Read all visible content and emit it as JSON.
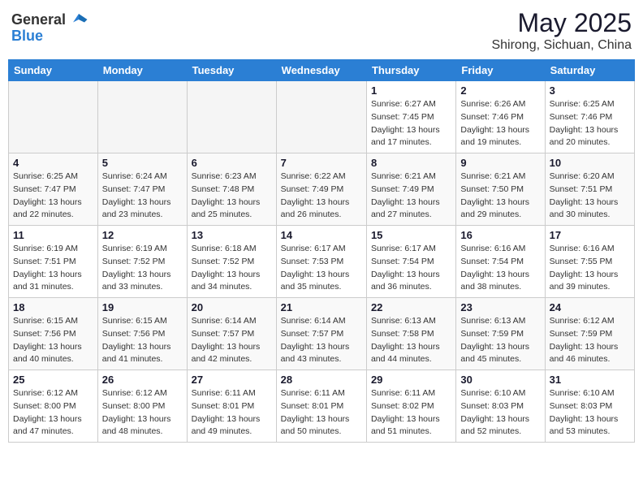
{
  "header": {
    "logo_general": "General",
    "logo_blue": "Blue",
    "month": "May 2025",
    "location": "Shirong, Sichuan, China"
  },
  "weekdays": [
    "Sunday",
    "Monday",
    "Tuesday",
    "Wednesday",
    "Thursday",
    "Friday",
    "Saturday"
  ],
  "weeks": [
    [
      {
        "day": "",
        "sunrise": "",
        "sunset": "",
        "daylight": ""
      },
      {
        "day": "",
        "sunrise": "",
        "sunset": "",
        "daylight": ""
      },
      {
        "day": "",
        "sunrise": "",
        "sunset": "",
        "daylight": ""
      },
      {
        "day": "",
        "sunrise": "",
        "sunset": "",
        "daylight": ""
      },
      {
        "day": "1",
        "sunrise": "6:27 AM",
        "sunset": "7:45 PM",
        "daylight": "13 hours and 17 minutes."
      },
      {
        "day": "2",
        "sunrise": "6:26 AM",
        "sunset": "7:46 PM",
        "daylight": "13 hours and 19 minutes."
      },
      {
        "day": "3",
        "sunrise": "6:25 AM",
        "sunset": "7:46 PM",
        "daylight": "13 hours and 20 minutes."
      }
    ],
    [
      {
        "day": "4",
        "sunrise": "6:25 AM",
        "sunset": "7:47 PM",
        "daylight": "13 hours and 22 minutes."
      },
      {
        "day": "5",
        "sunrise": "6:24 AM",
        "sunset": "7:47 PM",
        "daylight": "13 hours and 23 minutes."
      },
      {
        "day": "6",
        "sunrise": "6:23 AM",
        "sunset": "7:48 PM",
        "daylight": "13 hours and 25 minutes."
      },
      {
        "day": "7",
        "sunrise": "6:22 AM",
        "sunset": "7:49 PM",
        "daylight": "13 hours and 26 minutes."
      },
      {
        "day": "8",
        "sunrise": "6:21 AM",
        "sunset": "7:49 PM",
        "daylight": "13 hours and 27 minutes."
      },
      {
        "day": "9",
        "sunrise": "6:21 AM",
        "sunset": "7:50 PM",
        "daylight": "13 hours and 29 minutes."
      },
      {
        "day": "10",
        "sunrise": "6:20 AM",
        "sunset": "7:51 PM",
        "daylight": "13 hours and 30 minutes."
      }
    ],
    [
      {
        "day": "11",
        "sunrise": "6:19 AM",
        "sunset": "7:51 PM",
        "daylight": "13 hours and 31 minutes."
      },
      {
        "day": "12",
        "sunrise": "6:19 AM",
        "sunset": "7:52 PM",
        "daylight": "13 hours and 33 minutes."
      },
      {
        "day": "13",
        "sunrise": "6:18 AM",
        "sunset": "7:52 PM",
        "daylight": "13 hours and 34 minutes."
      },
      {
        "day": "14",
        "sunrise": "6:17 AM",
        "sunset": "7:53 PM",
        "daylight": "13 hours and 35 minutes."
      },
      {
        "day": "15",
        "sunrise": "6:17 AM",
        "sunset": "7:54 PM",
        "daylight": "13 hours and 36 minutes."
      },
      {
        "day": "16",
        "sunrise": "6:16 AM",
        "sunset": "7:54 PM",
        "daylight": "13 hours and 38 minutes."
      },
      {
        "day": "17",
        "sunrise": "6:16 AM",
        "sunset": "7:55 PM",
        "daylight": "13 hours and 39 minutes."
      }
    ],
    [
      {
        "day": "18",
        "sunrise": "6:15 AM",
        "sunset": "7:56 PM",
        "daylight": "13 hours and 40 minutes."
      },
      {
        "day": "19",
        "sunrise": "6:15 AM",
        "sunset": "7:56 PM",
        "daylight": "13 hours and 41 minutes."
      },
      {
        "day": "20",
        "sunrise": "6:14 AM",
        "sunset": "7:57 PM",
        "daylight": "13 hours and 42 minutes."
      },
      {
        "day": "21",
        "sunrise": "6:14 AM",
        "sunset": "7:57 PM",
        "daylight": "13 hours and 43 minutes."
      },
      {
        "day": "22",
        "sunrise": "6:13 AM",
        "sunset": "7:58 PM",
        "daylight": "13 hours and 44 minutes."
      },
      {
        "day": "23",
        "sunrise": "6:13 AM",
        "sunset": "7:59 PM",
        "daylight": "13 hours and 45 minutes."
      },
      {
        "day": "24",
        "sunrise": "6:12 AM",
        "sunset": "7:59 PM",
        "daylight": "13 hours and 46 minutes."
      }
    ],
    [
      {
        "day": "25",
        "sunrise": "6:12 AM",
        "sunset": "8:00 PM",
        "daylight": "13 hours and 47 minutes."
      },
      {
        "day": "26",
        "sunrise": "6:12 AM",
        "sunset": "8:00 PM",
        "daylight": "13 hours and 48 minutes."
      },
      {
        "day": "27",
        "sunrise": "6:11 AM",
        "sunset": "8:01 PM",
        "daylight": "13 hours and 49 minutes."
      },
      {
        "day": "28",
        "sunrise": "6:11 AM",
        "sunset": "8:01 PM",
        "daylight": "13 hours and 50 minutes."
      },
      {
        "day": "29",
        "sunrise": "6:11 AM",
        "sunset": "8:02 PM",
        "daylight": "13 hours and 51 minutes."
      },
      {
        "day": "30",
        "sunrise": "6:10 AM",
        "sunset": "8:03 PM",
        "daylight": "13 hours and 52 minutes."
      },
      {
        "day": "31",
        "sunrise": "6:10 AM",
        "sunset": "8:03 PM",
        "daylight": "13 hours and 53 minutes."
      }
    ]
  ]
}
